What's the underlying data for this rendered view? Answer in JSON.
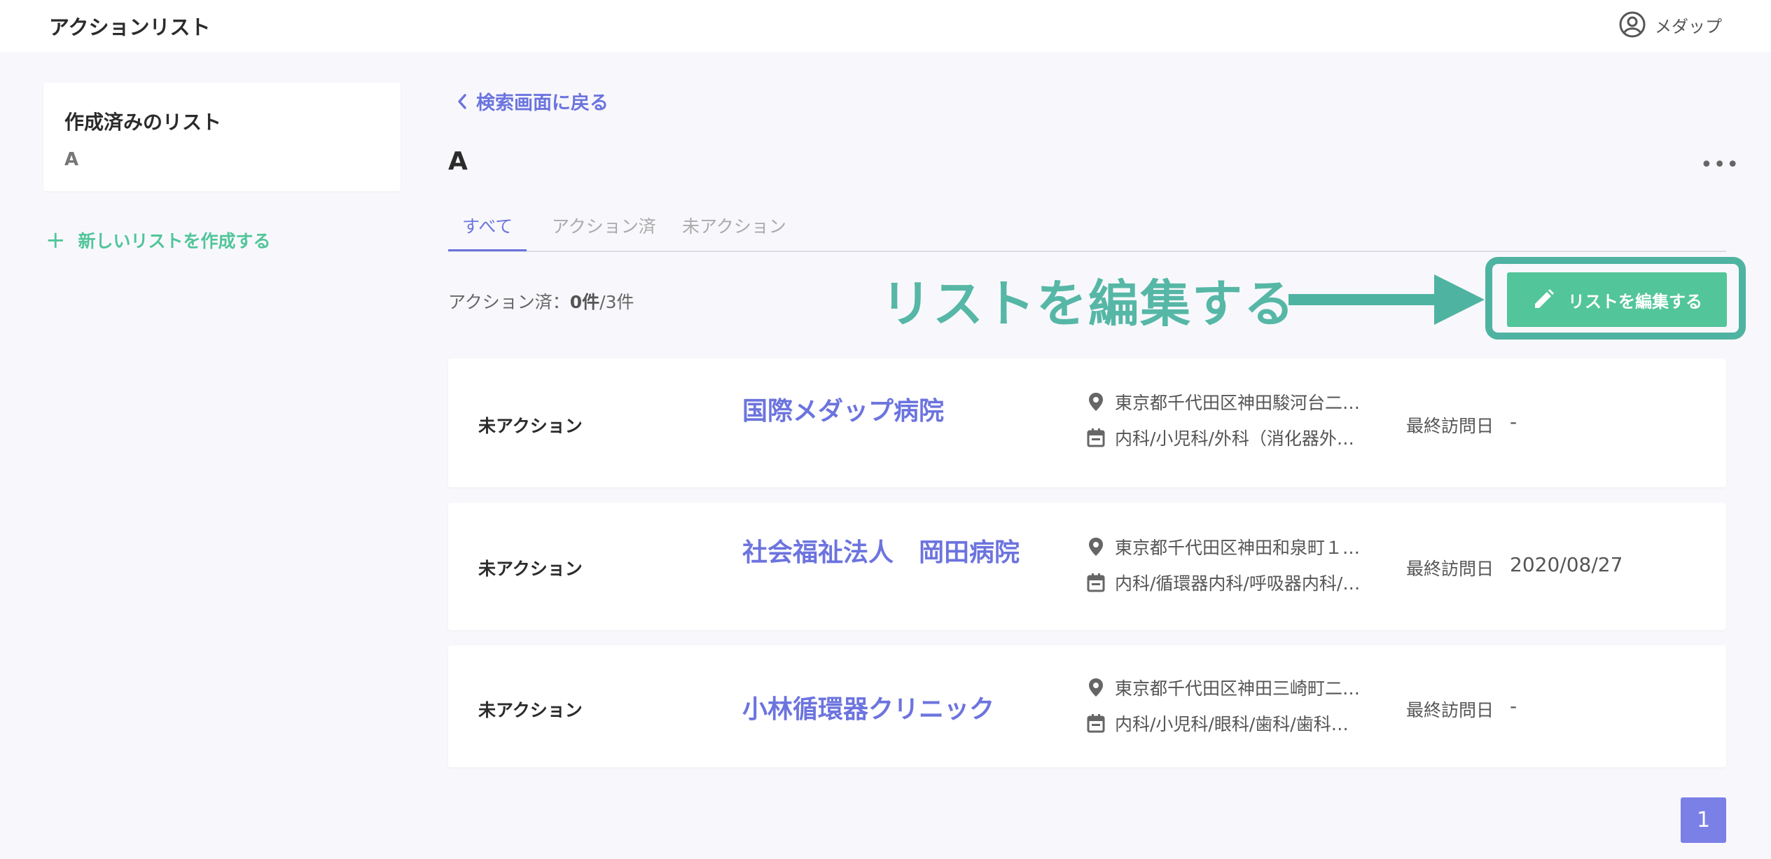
{
  "header": {
    "title": "アクションリスト",
    "user_name": "メダップ"
  },
  "sidebar": {
    "card_title": "作成済みのリスト",
    "lists": [
      "A"
    ],
    "new_list_label": "新しいリストを作成する"
  },
  "main": {
    "back_label": "検索画面に戻る",
    "list_name": "A",
    "more_label": "•••",
    "tabs": [
      {
        "label": "すべて"
      },
      {
        "label": "アクション済"
      },
      {
        "label": "未アクション"
      }
    ],
    "count": {
      "prefix": "アクション済：",
      "done": "0件",
      "total": "/3件"
    },
    "edit_button_label": "リストを編集する",
    "annotation_text": "リストを編集する",
    "visit_label": "最終訪問日",
    "rows": [
      {
        "status": "未アクション",
        "name": "国際メダップ病院",
        "address": "東京都千代田区神田駿河台二…",
        "departments": "内科/小児科/外科（消化器外…",
        "last_visit": "-"
      },
      {
        "status": "未アクション",
        "name": "社会福祉法人　岡田病院",
        "address": "東京都千代田区神田和泉町１…",
        "departments": "内科/循環器内科/呼吸器内科/…",
        "last_visit": "2020/08/27"
      },
      {
        "status": "未アクション",
        "name": "小林循環器クリニック",
        "address": "東京都千代田区神田三崎町二…",
        "departments": "内科/小児科/眼科/歯科/歯科…",
        "last_visit": "-"
      }
    ],
    "pagination": {
      "current_page": "1"
    }
  },
  "colors": {
    "accent": "#6c74de",
    "green": "#52c59a",
    "annotation": "#57b7a6"
  }
}
